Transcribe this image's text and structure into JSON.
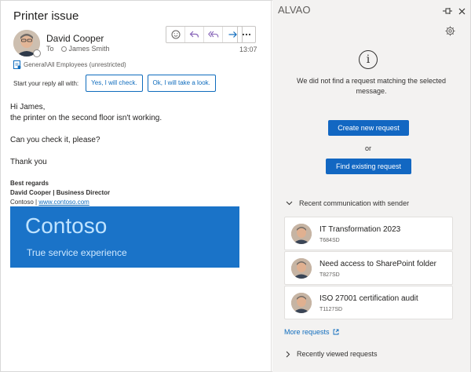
{
  "email": {
    "subject": "Printer issue",
    "sender_name": "David Cooper",
    "to_label": "To",
    "recipient": "James Smith",
    "time": "13:07",
    "sensitivity": "General\\All Employees (unrestricted)",
    "reply_label": "Start your reply all with:",
    "quick_replies": [
      "Yes, I will check.",
      "Ok, I will take a look."
    ],
    "body_lines": [
      "Hi James,",
      "the printer on the second floor isn't working.",
      "Can you check it, please?",
      "Thank you"
    ],
    "signature": {
      "greeting": "Best regards",
      "name_title": "David Cooper | Business Director",
      "company": "Contoso |",
      "link": "www.contoso.com"
    },
    "banner": {
      "title": "Contoso",
      "subtitle": "True service experience",
      "color": "#1a73c8"
    }
  },
  "addin": {
    "app_title": "ALVAO",
    "message": "We did not find a request matching the selected message.",
    "create_label": "Create new request",
    "or_label": "or",
    "find_label": "Find existing request",
    "recent_header": "Recent communication with sender",
    "requests": [
      {
        "title": "IT Transformation 2023",
        "id": "T684SD"
      },
      {
        "title": "Need access to SharePoint folder",
        "id": "T827SD"
      },
      {
        "title": "ISO 27001 certification audit",
        "id": "T1127SD"
      }
    ],
    "more_requests": "More requests",
    "recently_viewed": "Recently viewed requests",
    "accent": "#1267c2"
  }
}
